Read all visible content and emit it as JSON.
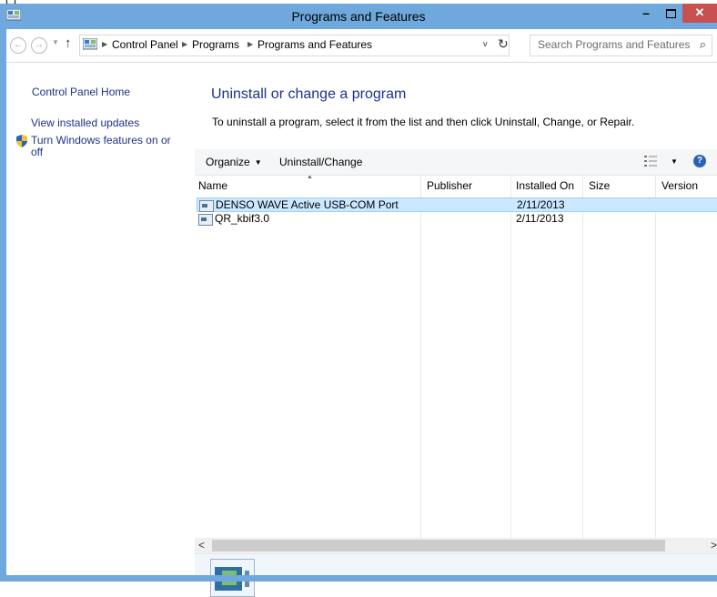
{
  "top_strip_text": "[          ]",
  "window": {
    "title": "Programs and Features"
  },
  "nav": {
    "crumbs": [
      "Control Panel",
      "Programs",
      "Programs and Features"
    ],
    "search_placeholder": "Search Programs and Features"
  },
  "left_pane": {
    "home": "Control Panel Home",
    "updates": "View installed updates",
    "features": "Turn Windows features on or off"
  },
  "main": {
    "heading": "Uninstall or change a program",
    "subheading": "To uninstall a program, select it from the list and then click Uninstall, Change, or Repair."
  },
  "toolbar": {
    "organize": "Organize",
    "uninstall_change": "Uninstall/Change"
  },
  "columns": [
    "Name",
    "Publisher",
    "Installed On",
    "Size",
    "Version"
  ],
  "rows": [
    {
      "name": "DENSO WAVE Active USB-COM Port",
      "publisher": "",
      "installed_on": "2/11/2013",
      "size": "",
      "version": "",
      "selected": true
    },
    {
      "name": "QR_kbif3.0",
      "publisher": "",
      "installed_on": "2/11/2013",
      "size": "",
      "version": "",
      "selected": false
    }
  ],
  "scrollbar": {
    "left": "<",
    "right": ">"
  },
  "colors": {
    "frame": "#6fa8dc",
    "close": "#c75050",
    "link": "#1e3287",
    "selection": "#cce8ff"
  }
}
